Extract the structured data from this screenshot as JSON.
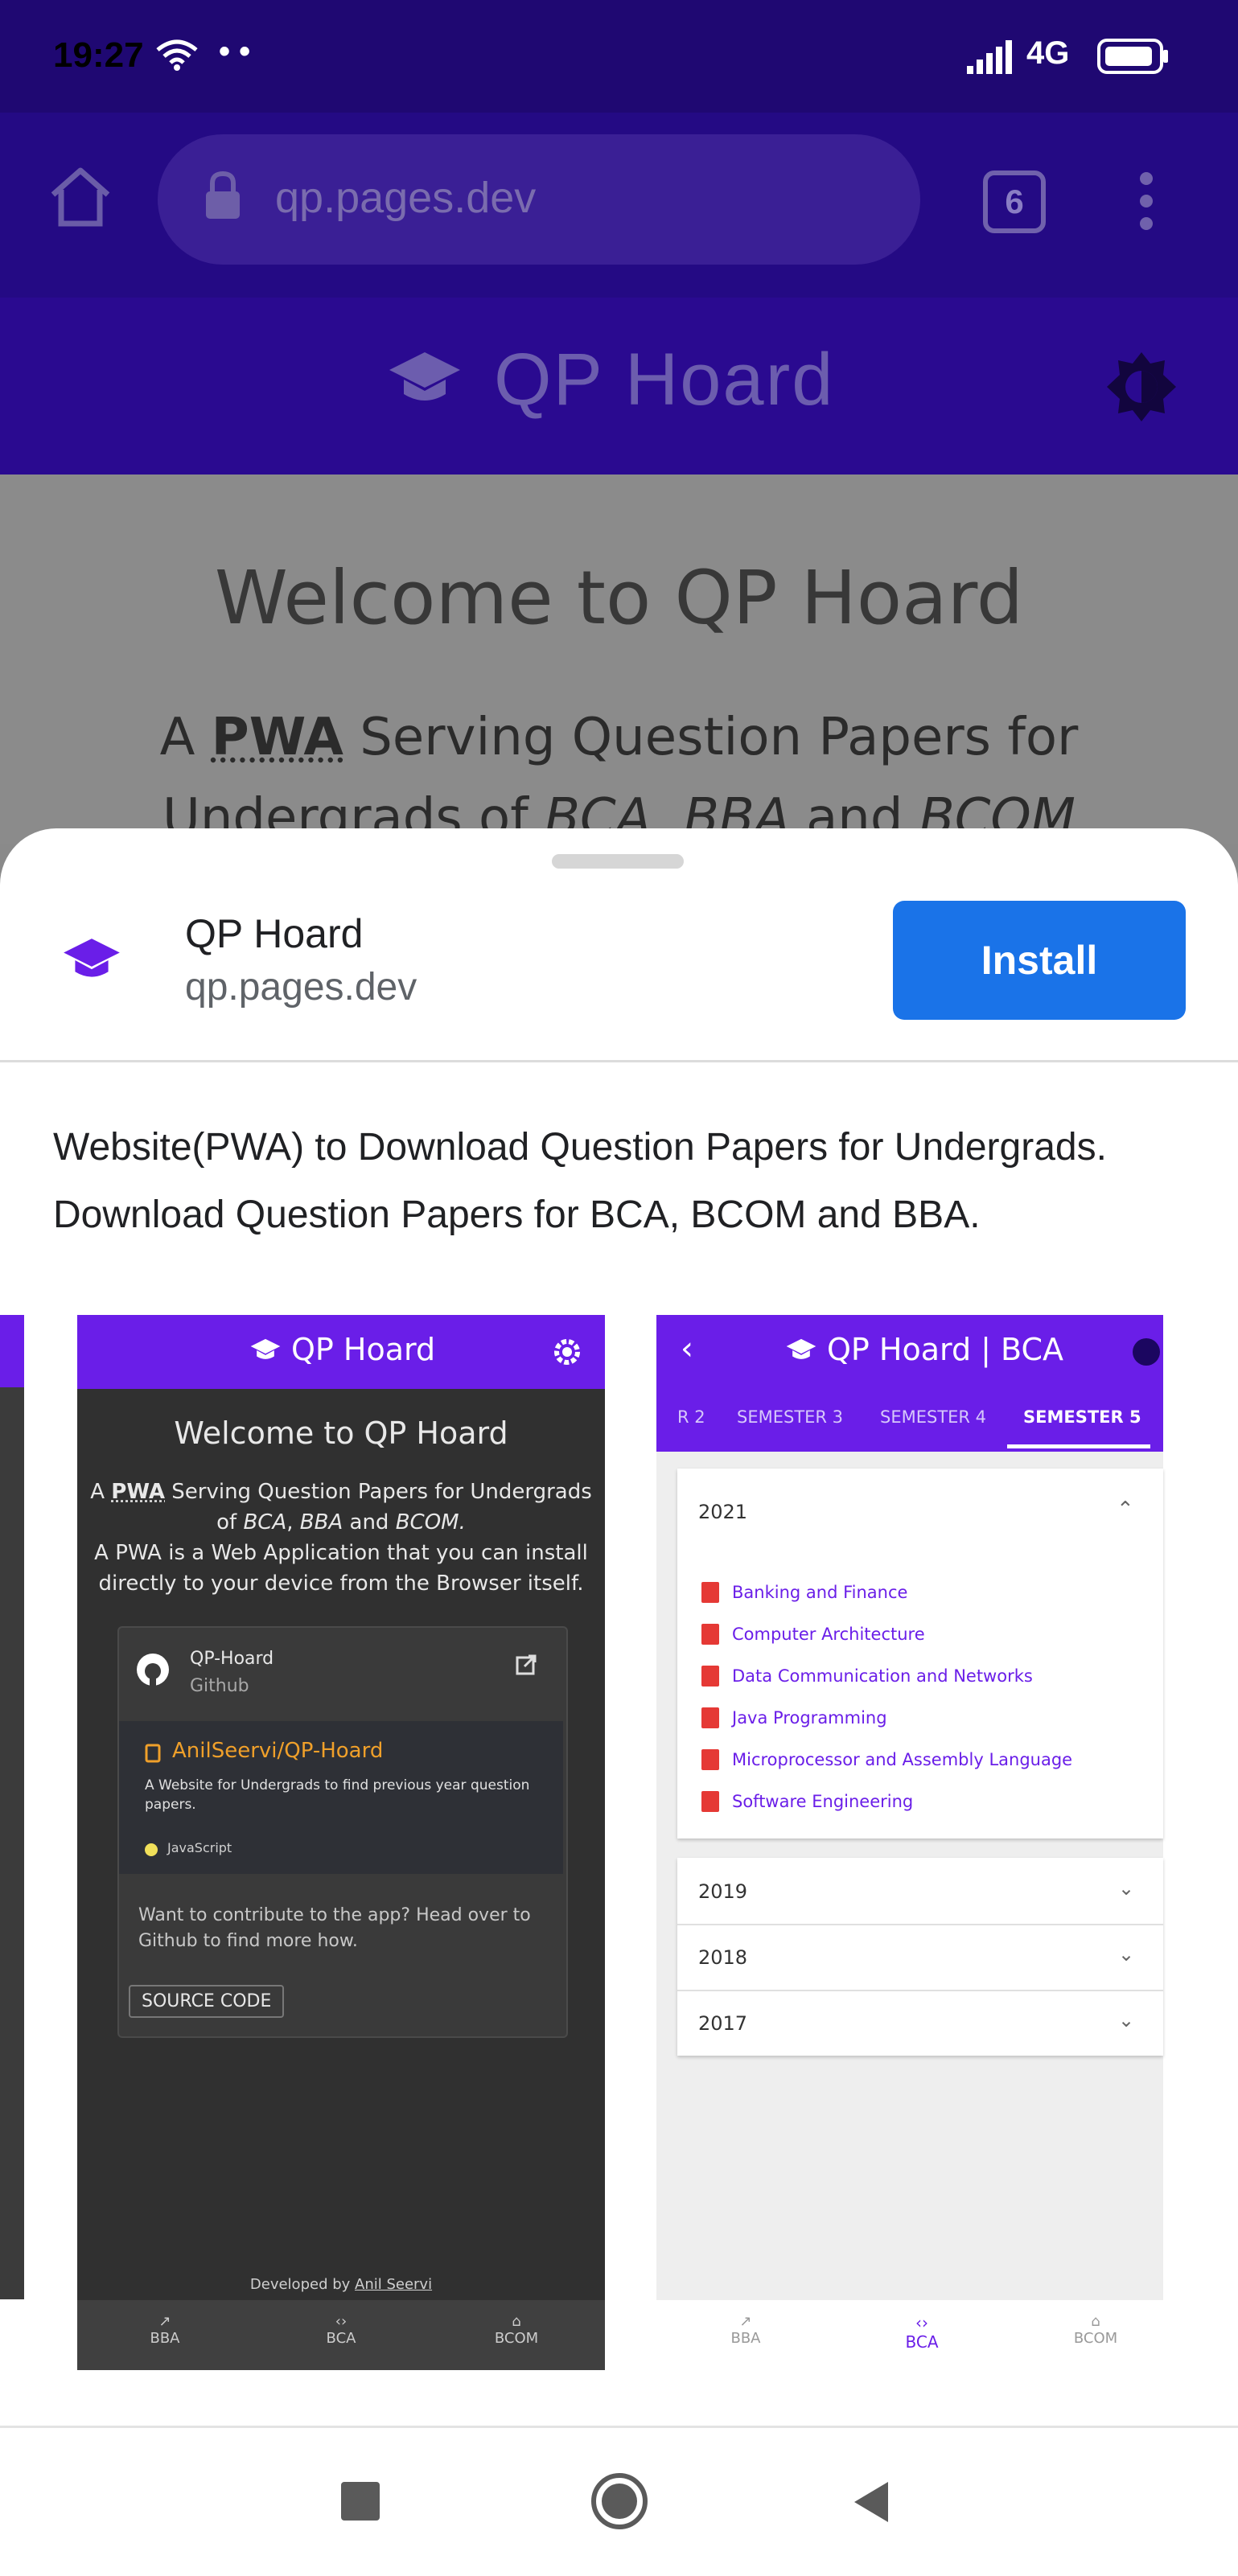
{
  "status_bar": {
    "time": "19:27",
    "dots": "• •",
    "network": "4G"
  },
  "browser": {
    "url": "qp.pages.dev",
    "tab_count": "6"
  },
  "app_header": {
    "title": "QP Hoard"
  },
  "page": {
    "welcome": "Welcome to QP Hoard",
    "tagline_prefix": "A ",
    "tagline_pwa": "PWA",
    "tagline_rest": " Serving Question Papers for",
    "tagline_line2_a": "Undergrads of ",
    "tagline_line2_b": "BCA",
    "tagline_line2_c": ", ",
    "tagline_line2_d": "BBA",
    "tagline_line2_e": " and ",
    "tagline_line2_f": "BCOM"
  },
  "install_sheet": {
    "app_name": "QP Hoard",
    "app_url": "qp.pages.dev",
    "install_label": "Install",
    "description_line1": "Website(PWA) to Download Question Papers for Undergrads.",
    "description_line2": "Download Question Papers for BCA, BCOM and BBA."
  },
  "screenshot1": {
    "title": "QP Hoard",
    "welcome": "Welcome to QP Hoard",
    "line1_a": "A ",
    "line1_pwa": "PWA",
    "line1_b": " Serving Question Papers for Undergrads",
    "line2_a": "of ",
    "line2_bca": "BCA",
    "line2_sep": ", ",
    "line2_bba": "BBA",
    "line2_and": " and ",
    "line2_bcom": "BCOM.",
    "line3": "A PWA is a Web Application that you can install",
    "line4": "directly to your device from the Browser itself.",
    "card_title": "QP-Hoard",
    "card_subtitle": "Github",
    "repo_name": "AnilSeervi/QP-Hoard",
    "repo_desc": "A Website for Undergrads to find previous year question papers.",
    "repo_lang": "JavaScript",
    "contribute": "Want to contribute to the app? Head over to Github to find more how.",
    "source_btn": "SOURCE CODE",
    "footer_prefix": "Developed by ",
    "footer_name": "Anil Seervi",
    "nav": [
      "BBA",
      "BCA",
      "BCOM"
    ]
  },
  "screenshot2": {
    "title": "QP Hoard | BCA",
    "tabs": [
      "R 2",
      "SEMESTER 3",
      "SEMESTER 4",
      "SEMESTER 5"
    ],
    "year_open": "2021",
    "subjects": [
      "Banking and Finance",
      "Computer Architecture",
      "Data Communication and Networks",
      "Java Programming",
      "Microprocessor and Assembly Language",
      "Software Engineering"
    ],
    "years_closed": [
      "2019",
      "2018",
      "2017"
    ],
    "nav": [
      "BBA",
      "BCA",
      "BCOM"
    ]
  },
  "colors": {
    "purple": "#6a1ee8",
    "install_blue": "#1a73e8",
    "status_bg": "#1f0872"
  }
}
